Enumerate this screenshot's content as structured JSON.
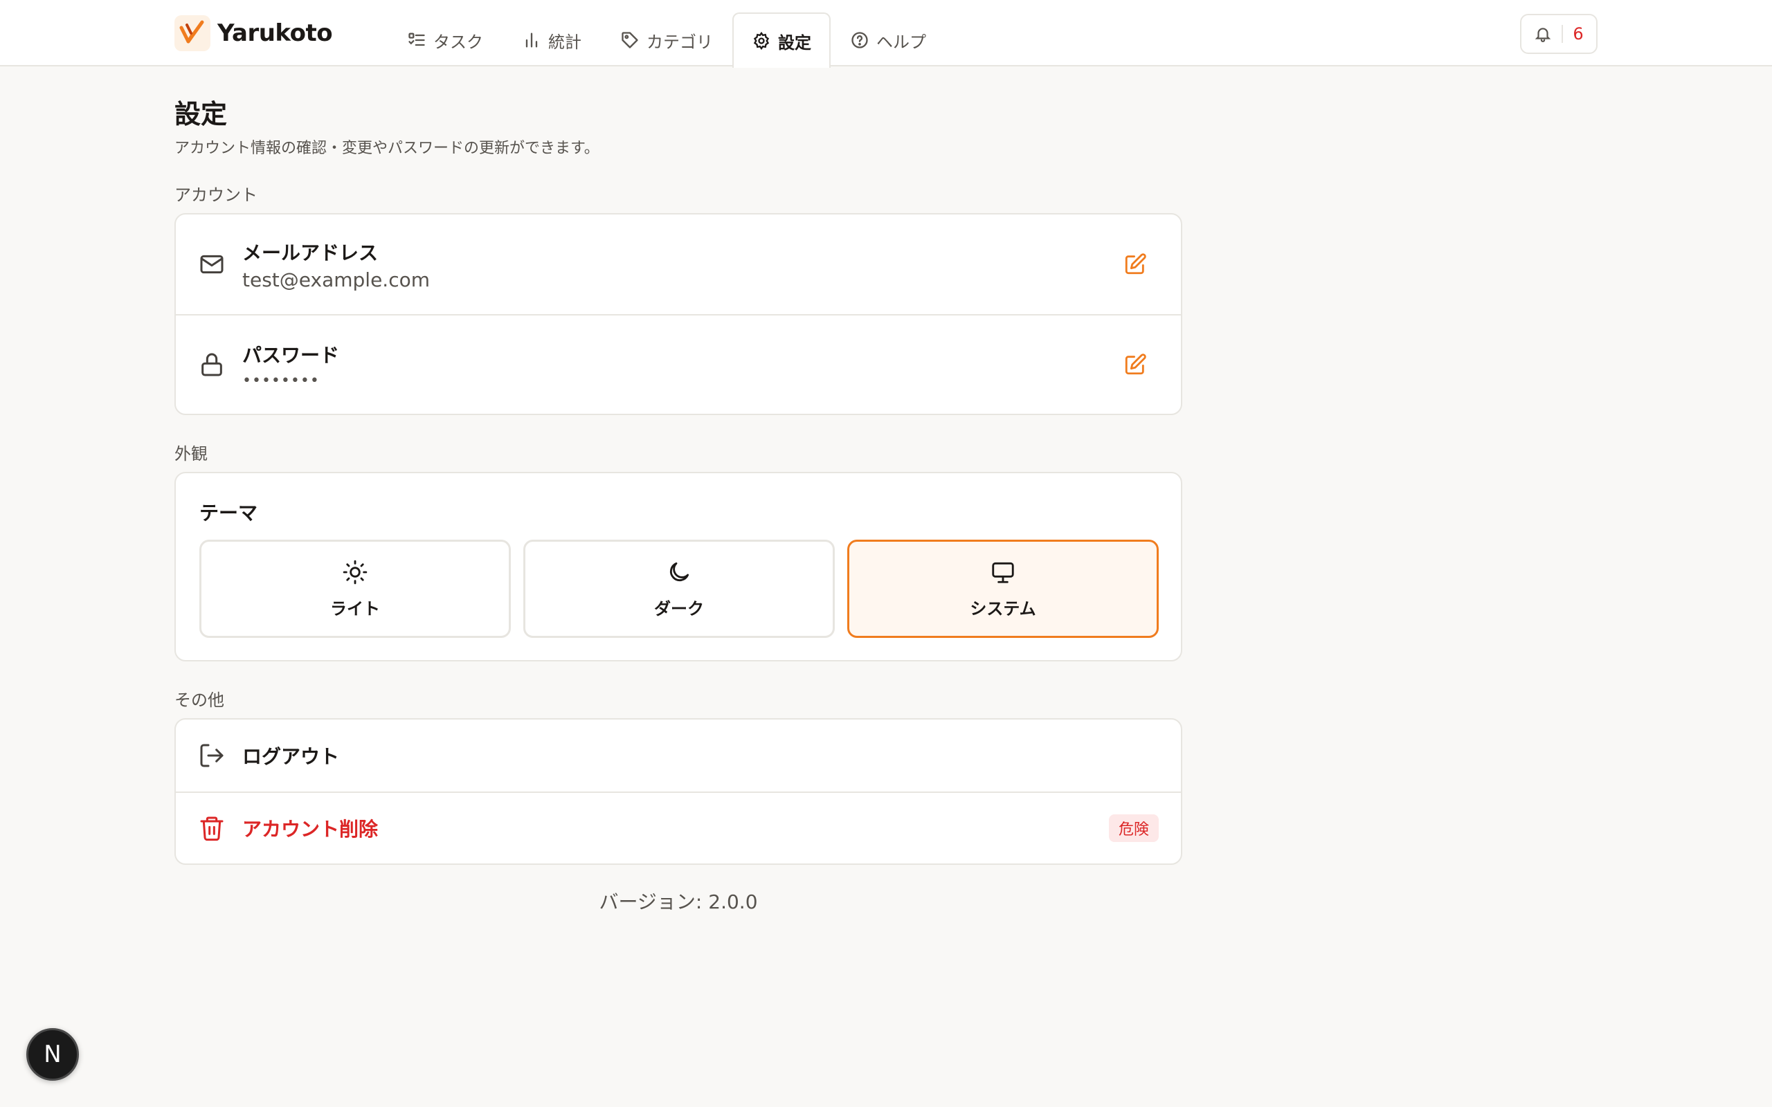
{
  "app": {
    "name": "Yarukoto"
  },
  "nav": [
    {
      "label": "タスク",
      "icon": "list-todo-icon"
    },
    {
      "label": "統計",
      "icon": "bar-chart-icon"
    },
    {
      "label": "カテゴリ",
      "icon": "tag-icon"
    },
    {
      "label": "設定",
      "icon": "gear-icon",
      "active": true
    },
    {
      "label": "ヘルプ",
      "icon": "help-circle-icon"
    }
  ],
  "notifications": {
    "count": "6"
  },
  "page": {
    "title": "設定",
    "description": "アカウント情報の確認・変更やパスワードの更新ができます。"
  },
  "account": {
    "label": "アカウント",
    "email": {
      "title": "メールアドレス",
      "value": "test@example.com"
    },
    "password": {
      "title": "パスワード",
      "value": "••••••••"
    }
  },
  "appearance": {
    "label": "外観",
    "theme_title": "テーマ",
    "options": [
      {
        "label": "ライト",
        "icon": "sun-icon"
      },
      {
        "label": "ダーク",
        "icon": "moon-icon"
      },
      {
        "label": "システム",
        "icon": "monitor-icon",
        "selected": true
      }
    ]
  },
  "other": {
    "label": "その他",
    "logout": "ログアウト",
    "delete_account": "アカウント削除",
    "danger_badge": "危険"
  },
  "version": "バージョン: 2.0.0",
  "dev_badge": "N",
  "colors": {
    "accent": "#f07c1e",
    "danger": "#dc2626",
    "background": "#f9f8f6"
  }
}
